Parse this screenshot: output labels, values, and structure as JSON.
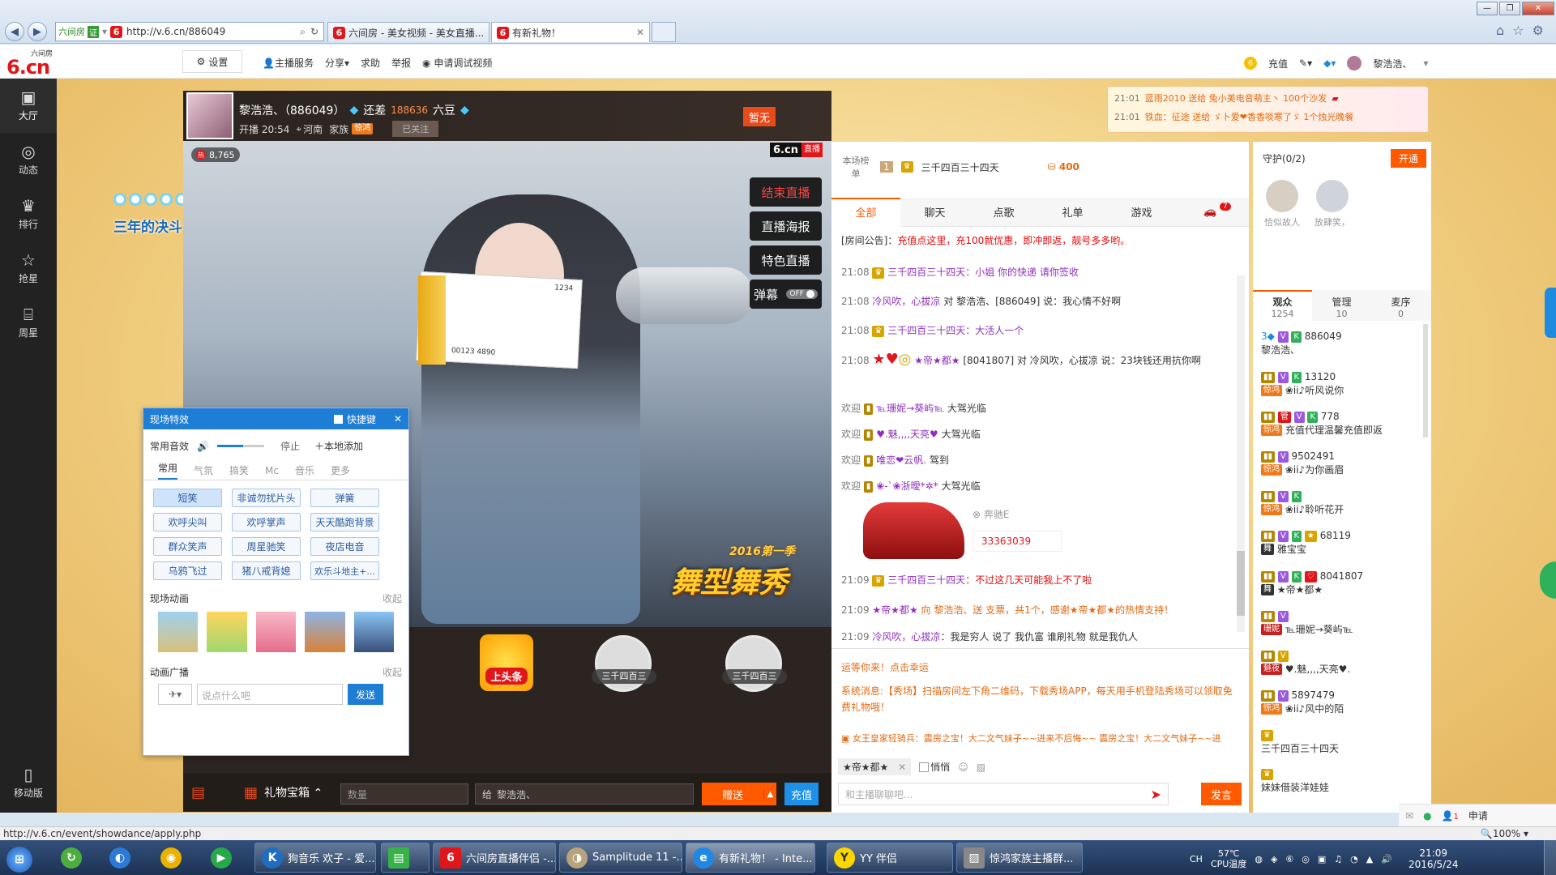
{
  "browser": {
    "addr_prefix": "六间房",
    "addr_badge": "证",
    "url": "http://v.6.cn/886049",
    "tabs": [
      {
        "label": "六间房 - 美女视频 - 美女直播..."
      },
      {
        "label": "有新礼物！"
      }
    ]
  },
  "site_header": {
    "logo_small": "六间房",
    "logo_main": "6.cn",
    "settings": "设置",
    "host_service": "主播服务",
    "share": "分享",
    "help": "求助",
    "report": "举报",
    "apply_debug": "申请调试视频",
    "recharge": "充值",
    "username": "黎浩浩、"
  },
  "sidebar": {
    "items": [
      {
        "label": "大厅",
        "icon": "tv-icon"
      },
      {
        "label": "动态",
        "icon": "compass-icon"
      },
      {
        "label": "排行",
        "icon": "crown-icon"
      },
      {
        "label": "抢星",
        "icon": "star-icon"
      },
      {
        "label": "周星",
        "icon": "gift-icon"
      }
    ],
    "mobile": "移动版"
  },
  "decor_text": "三年的决斗",
  "host": {
    "name": "黎浩浩、（886049）",
    "diff_label": "还差",
    "diff_value": "188636",
    "diff_unit": "六豆",
    "start_time": "开播 20:54",
    "location": "河南",
    "family_label": "家族",
    "family_badge": "惊鸿",
    "follow_btn": "已关注",
    "tag": "暂无",
    "viewers_count": "8,765",
    "watermark": "6.cn",
    "watermark_live": "直播"
  },
  "video_buttons": {
    "end": "结束直播",
    "poster": "直播海报",
    "feature": "特色直播",
    "danmaku": "弹幕",
    "danmaku_state": "OFF"
  },
  "video_overlay": {
    "year": "2016第一季",
    "show": "舞型舞秀",
    "cheque_num": "1234",
    "cheque_bottom": "00123 4890"
  },
  "seats": [
    {
      "label": "上头条"
    },
    {
      "label": "三千四百三"
    },
    {
      "label": "三千四百三"
    }
  ],
  "bottom_bar": {
    "gift_box": "礼物宝箱",
    "qty_placeholder": "数量",
    "to_label": "给",
    "to_name": "黎浩浩、",
    "send": "赠送",
    "recharge": "充值"
  },
  "fx_panel": {
    "title": "现场特效",
    "shortcut": "快捷键",
    "sound_label": "常用音效",
    "stop": "停止",
    "local_add": "本地添加",
    "tabs": [
      "常用",
      "气氛",
      "搞笑",
      "Mc",
      "音乐",
      "更多"
    ],
    "buttons": [
      "短笑",
      "非诚勿扰片头",
      "弹簧",
      "欢呼尖叫",
      "欢呼掌声",
      "天天酷跑背景",
      "群众笑声",
      "周星驰笑",
      "夜店电音",
      "乌鸦飞过",
      "猪八戒背媳",
      "欢乐斗地主+..."
    ],
    "anim_label": "现场动画",
    "collapse": "收起",
    "broadcast_label": "动画广播",
    "collapse2": "收起",
    "input_placeholder": "说点什么吧",
    "send": "发送"
  },
  "chat": {
    "rank_label": "本场榜单",
    "rank_num": "1",
    "rank_name": "三千四百三十四天",
    "rank_beans": "400",
    "tabs": [
      "全部",
      "聊天",
      "点歌",
      "礼单",
      "游戏"
    ],
    "tab_badge": "7",
    "announcement_label": "[房间公告]：",
    "announcement": "充值点这里，充100就优惠，即冲即返，靓号多多哟。",
    "messages": [
      {
        "time": "21:08",
        "name": "三千四百三十四天",
        "text": "：小姐 你的快递 请你签收"
      },
      {
        "time": "21:08",
        "name": "冷风吹，心拔凉",
        "text": "对 黎浩浩、[886049] 说：我心情不好啊"
      },
      {
        "time": "21:08",
        "name": "三千四百三十四天",
        "text": "：大活人一个"
      },
      {
        "time": "21:08",
        "name": "★帝★都★",
        "text": "[8041807] 对 冷风吹，心拔凉 说：23块钱还用抗你啊"
      },
      {
        "time": "欢迎",
        "name": "℡珊妮→葵屿℡",
        "text": "大驾光临"
      },
      {
        "time": "欢迎",
        "name": "♥.魅,,,,天亮♥",
        "text": "大驾光临"
      },
      {
        "time": "欢迎",
        "name": "唯恋❤云帆.",
        "text": "驾到"
      },
      {
        "time": "欢迎",
        "name": "❀-`❀浙曖*✲*",
        "text": "大驾光临"
      },
      {
        "time": "21:09",
        "name": "三千四百三十四天",
        "text": "：不过这几天可能我上不了啦"
      },
      {
        "time": "21:09",
        "name": "★帝★都★",
        "text": "向 黎浩浩、送 支票，共1个，感谢★帝★都★的热情支持！"
      },
      {
        "time": "21:09",
        "name": "冷风吹，心拔凉",
        "text": "：我是穷人 说了 我仇富 谁刷礼物 就是我仇人"
      }
    ],
    "car_name": "奔驰E",
    "car_id": "33363039",
    "lucky": "运等你来！点击幸运",
    "system_label": "系统消息:",
    "system": "【秀场】扫描房间左下角二维码，下载秀场APP，每天用手机登陆秀场可以领取免费礼物哦！",
    "marquee": "女王皇家轻骑兵：震房之宝！大二文气妹子~~进来不后悔~~ 震房之宝！大二文气妹子~~进",
    "to_user": "★帝★都★",
    "whisper": "悄悄",
    "input_placeholder": "和主播聊聊吧...",
    "send": "发言"
  },
  "live_gifts": [
    {
      "time": "21:01",
      "text": "蓝雨2010 送给 兔小美电音萌主丶 100个沙发"
    },
    {
      "time": "21:01",
      "text": "铁血：征途 送给 ゞ卜爱❤香香啖寒了ゞ 1个烛光晚餐"
    }
  ],
  "guard": {
    "label": "守护(0/2)",
    "open": "开通",
    "members": [
      "恰似故人",
      "放肆笑，"
    ]
  },
  "audience": {
    "tabs": [
      {
        "label": "观众",
        "count": "1254"
      },
      {
        "label": "管理",
        "count": "10"
      },
      {
        "label": "麦序",
        "count": "0"
      }
    ],
    "users": [
      {
        "id": "886049",
        "name": "黎浩浩、"
      },
      {
        "id": "13120",
        "name": "❀ii♪听风说你"
      },
      {
        "id": "778",
        "name": "充值代理温馨充值即返"
      },
      {
        "id": "9502491",
        "name": "❀ii♪为你画眉"
      },
      {
        "id": "",
        "name": "❀ii♪聆听花开"
      },
      {
        "id": "68119",
        "name": "雅宝宝"
      },
      {
        "id": "8041807",
        "name": "★帝★都★"
      },
      {
        "id": "",
        "name": "℡珊妮→葵屿℡"
      },
      {
        "id": "",
        "name": "♥.魅,,,,天亮♥."
      },
      {
        "id": "5897479",
        "name": "❀ii♪风中的陌"
      },
      {
        "id": "",
        "name": "三千四百三十四天"
      },
      {
        "id": "",
        "name": "妹妹借装洋娃娃"
      }
    ],
    "apply": "申请",
    "apply_badge": "1"
  },
  "statusbar": {
    "url": "http://v.6.cn/event/showdance/apply.php",
    "zoom": "100%"
  },
  "taskbar": {
    "items": [
      {
        "label": "狗音乐 欢子 - 爱..."
      },
      {
        "label": "六间房直播伴侣 -..."
      },
      {
        "label": "Samplitude 11 -..."
      },
      {
        "label": "有新礼物！ - Inte..."
      },
      {
        "label": "YY 伴侣"
      },
      {
        "label": "惊鸿家族主播群..."
      }
    ],
    "lang": "CH",
    "temp": "57℃",
    "temp_label": "CPU温度",
    "time": "21:09",
    "date": "2016/5/24"
  },
  "colors": {
    "accent": "#ff5a00",
    "brand": "#e0161b",
    "chat_name": "#8e2fbd",
    "link": "#2a6cbd"
  }
}
